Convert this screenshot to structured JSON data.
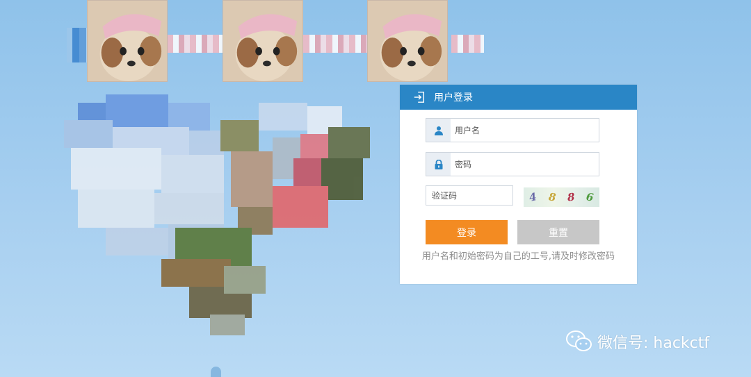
{
  "login": {
    "title": "用户登录",
    "username_placeholder": "用户名",
    "password_placeholder": "密码",
    "captcha_placeholder": "验证码",
    "captcha_chars": [
      "4",
      "8",
      "8",
      "6"
    ],
    "login_button": "登录",
    "reset_button": "重置",
    "hint": "用户名和初始密码为自己的工号,请及时修改密码"
  },
  "watermark": {
    "text": "微信号: hackctf"
  },
  "colors": {
    "header": "#2a86c6",
    "login_button": "#f38b22",
    "reset_button": "#c7c7c7",
    "background": "#a7cff0"
  },
  "icons": {
    "header": "login-arrow-icon",
    "username": "user-icon",
    "password": "lock-icon",
    "watermark": "wechat-icon"
  }
}
